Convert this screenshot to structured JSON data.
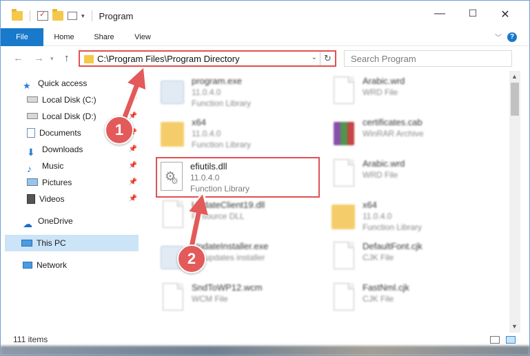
{
  "window": {
    "title": "Program",
    "controls": {
      "minimize": "—",
      "maximize": "☐",
      "close": "✕"
    }
  },
  "ribbon": {
    "tabs": [
      "File",
      "Home",
      "Share",
      "View"
    ],
    "help": "?"
  },
  "address": {
    "path": "C:\\Program Files\\Program Directory",
    "search_placeholder": "Search Program"
  },
  "sidebar": {
    "items": [
      {
        "label": "Quick access",
        "icon": "star-icon",
        "pinned": false
      },
      {
        "label": "Local Disk (C:)",
        "icon": "drive-icon",
        "pinned": true
      },
      {
        "label": "Local Disk (D:)",
        "icon": "drive-icon",
        "pinned": true
      },
      {
        "label": "Documents",
        "icon": "documents-icon",
        "pinned": true
      },
      {
        "label": "Downloads",
        "icon": "download-icon",
        "pinned": true
      },
      {
        "label": "Music",
        "icon": "music-icon",
        "pinned": true
      },
      {
        "label": "Pictures",
        "icon": "pictures-icon",
        "pinned": true
      },
      {
        "label": "Videos",
        "icon": "videos-icon",
        "pinned": true
      },
      {
        "label": "OneDrive",
        "icon": "cloud-icon",
        "pinned": false
      },
      {
        "label": "This PC",
        "icon": "computer-icon",
        "pinned": false,
        "selected": true
      },
      {
        "label": "Network",
        "icon": "network-icon",
        "pinned": false
      }
    ]
  },
  "files": {
    "left": [
      {
        "name": "program.exe",
        "line2": "11.0.4.0",
        "line3": "Function Library",
        "type": "exe"
      },
      {
        "name": "x64",
        "line2": "11.0.4.0",
        "line3": "Function Library",
        "type": "folder"
      },
      {
        "name": "efiutils.dll",
        "line2": "11.0.4.0",
        "line3": "Function Library",
        "type": "dll",
        "highlighted": true
      },
      {
        "name": "UpdateClient19.dll",
        "line2": "Resource DLL",
        "line3": "",
        "type": "dll"
      },
      {
        "name": "UpdateInstaller.exe",
        "line2": "BY updates installer",
        "line3": "",
        "type": "exe"
      },
      {
        "name": "SndToWP12.wcm",
        "line2": "WCM File",
        "line3": "",
        "type": "doc"
      }
    ],
    "right": [
      {
        "name": "Arabic.wrd",
        "line2": "WRD File",
        "line3": "",
        "type": "doc"
      },
      {
        "name": "certificates.cab",
        "line2": "WinRAR Archive",
        "line3": "",
        "type": "rar"
      },
      {
        "name": "Arabic.wrd",
        "line2": "WRD File",
        "line3": "",
        "type": "doc"
      },
      {
        "name": "x64",
        "line2": "11.0.4.0",
        "line3": "Function Library",
        "type": "folder"
      },
      {
        "name": "DefaultFont.cjk",
        "line2": "CJK File",
        "line3": "",
        "type": "doc"
      },
      {
        "name": "FastNml.cjk",
        "line2": "CJK File",
        "line3": "",
        "type": "doc"
      }
    ]
  },
  "status": {
    "count": "111 items"
  },
  "annotations": {
    "step1": "1",
    "step2": "2"
  },
  "colors": {
    "accent": "#1979ca",
    "highlight": "#e05050",
    "badge": "#e35a5a"
  }
}
